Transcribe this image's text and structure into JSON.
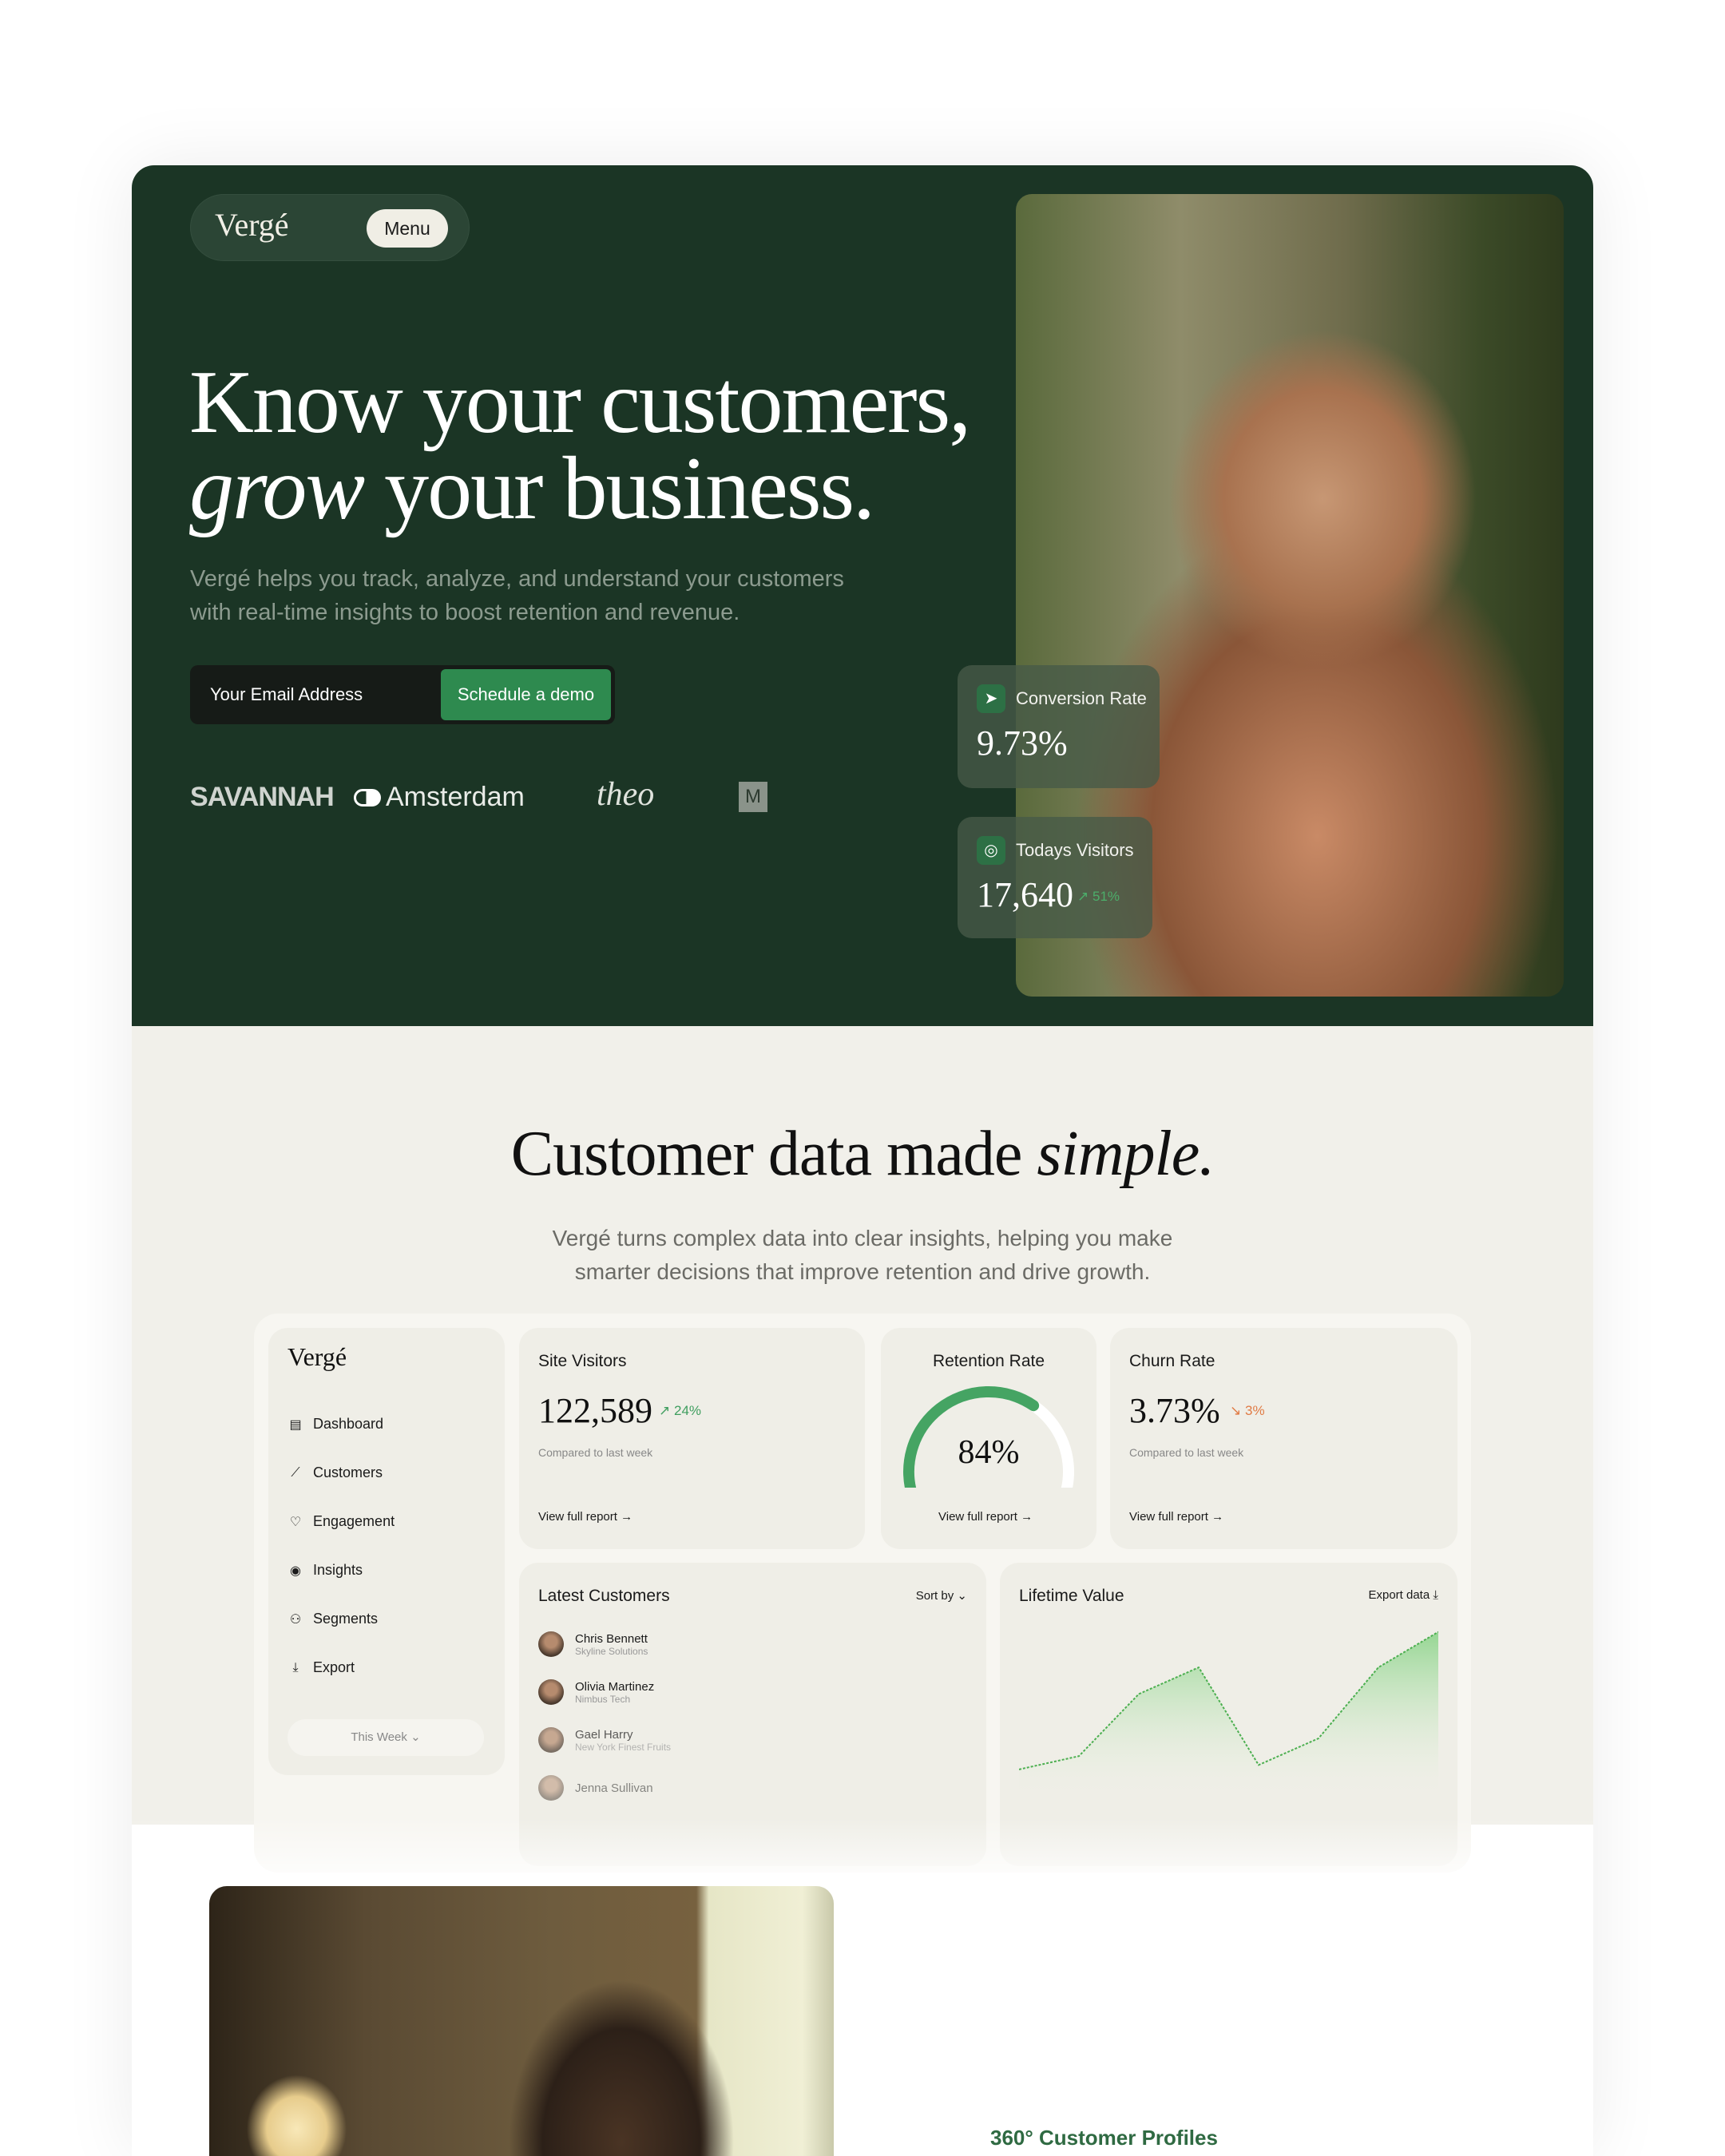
{
  "brand": "Vergé",
  "nav": {
    "menu_label": "Menu"
  },
  "hero": {
    "headline_line1": "Know your customers,",
    "headline_italic": "grow",
    "headline_rest": " your business.",
    "subtitle": "Vergé helps you track, analyze, and understand your customers with real-time insights to boost retention and revenue.",
    "email_placeholder": "Your Email Address",
    "cta_label": "Schedule a demo",
    "logos": [
      "SAVANNAH",
      "Amsterdam",
      "theo",
      "M"
    ],
    "stats": [
      {
        "icon": "send-icon",
        "label": "Conversion Rate",
        "value": "9.73%"
      },
      {
        "icon": "chrome-icon",
        "label": "Todays Visitors",
        "value": "17,640",
        "change": "51%",
        "trend": "up"
      }
    ]
  },
  "section2": {
    "title_start": "Customer data made ",
    "title_italic": "simple.",
    "subtitle": "Vergé turns complex data into clear insights, helping you make smarter decisions that improve retention and drive growth."
  },
  "dashboard": {
    "logo": "Vergé",
    "sidebar": [
      {
        "icon": "dashboard-icon",
        "label": "Dashboard"
      },
      {
        "icon": "chart-line-icon",
        "label": "Customers"
      },
      {
        "icon": "heart-icon",
        "label": "Engagement"
      },
      {
        "icon": "eye-icon",
        "label": "Insights"
      },
      {
        "icon": "users-icon",
        "label": "Segments"
      },
      {
        "icon": "download-icon",
        "label": "Export"
      }
    ],
    "period": "This Week",
    "site_visitors": {
      "title": "Site Visitors",
      "value": "122,589",
      "change": "24%",
      "note": "Compared to last week",
      "link": "View full report"
    },
    "retention": {
      "title": "Retention Rate",
      "value": "84%",
      "percent": 84,
      "link": "View full report"
    },
    "churn": {
      "title": "Churn Rate",
      "value": "3.73%",
      "change": "3%",
      "note": "Compared to last week",
      "link": "View full report"
    },
    "latest": {
      "title": "Latest Customers",
      "sort": "Sort by",
      "customers": [
        {
          "name": "Chris Bennett",
          "company": "Skyline Solutions"
        },
        {
          "name": "Olivia Martinez",
          "company": "Nimbus Tech"
        },
        {
          "name": "Gael Harry",
          "company": "New York Finest Fruits"
        },
        {
          "name": "Jenna Sullivan",
          "company": ""
        }
      ]
    },
    "lifetime": {
      "title": "Lifetime Value",
      "export": "Export data"
    }
  },
  "chart_data": {
    "type": "area",
    "title": "Lifetime Value",
    "values": [
      2,
      5,
      19,
      25,
      3,
      9,
      25,
      33
    ],
    "color": "#4caf50"
  },
  "colors": {
    "hero_bg": "#1b3525",
    "accent": "#2e8a4f",
    "up": "#3f9e5f",
    "down": "#e07b45",
    "section_bg": "#f1f0ea"
  },
  "feature_label": "360° Customer Profiles"
}
